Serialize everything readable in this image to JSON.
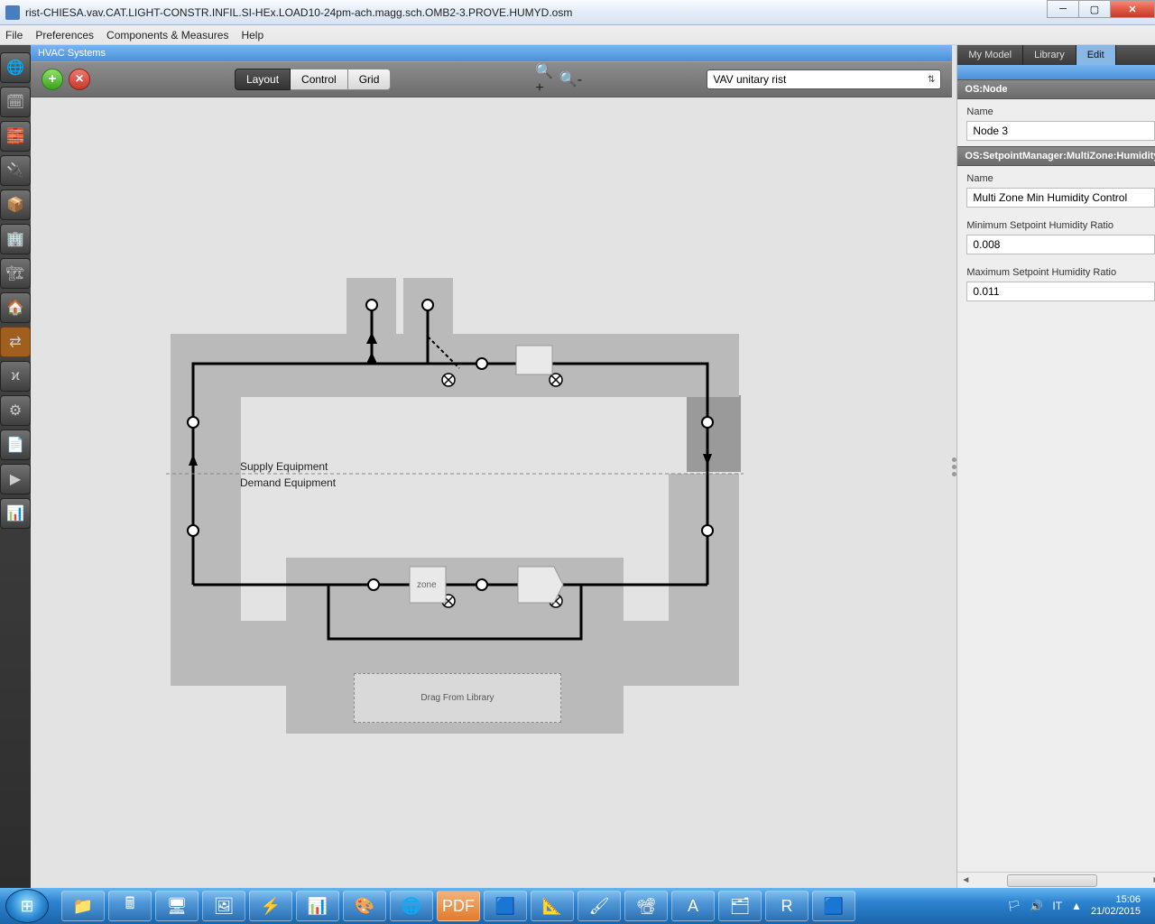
{
  "window": {
    "title": "rist-CHIESA.vav.CAT.LIGHT-CONSTR.INFIL.SI-HEx.LOAD10-24pm-ach.magg.sch.OMB2-3.PROVE.HUMYD.osm"
  },
  "menu": {
    "file": "File",
    "preferences": "Preferences",
    "components": "Components & Measures",
    "help": "Help"
  },
  "panel": {
    "title": "HVAC Systems"
  },
  "toolbar": {
    "layout": "Layout",
    "control": "Control",
    "grid": "Grid",
    "system_selected": "VAV unitary rist"
  },
  "canvas": {
    "supply_label": "Supply Equipment",
    "demand_label": "Demand Equipment",
    "zone_label": "zone",
    "drop_label": "Drag From Library"
  },
  "right": {
    "tabs": {
      "mymodel": "My Model",
      "library": "Library",
      "edit": "Edit"
    },
    "section1": "OS:Node",
    "label_name1": "Name",
    "value_name1": "Node 3",
    "section2": "OS:SetpointManager:MultiZone:Humidity:",
    "label_name2": "Name",
    "value_name2": "Multi Zone Min Humidity Control",
    "label_min": "Minimum Setpoint Humidity Ratio",
    "value_min": "0.008",
    "label_max": "Maximum Setpoint Humidity Ratio",
    "value_max": "0.011"
  },
  "taskbar": {
    "lang": "IT",
    "time": "15:06",
    "date": "21/02/2015"
  }
}
